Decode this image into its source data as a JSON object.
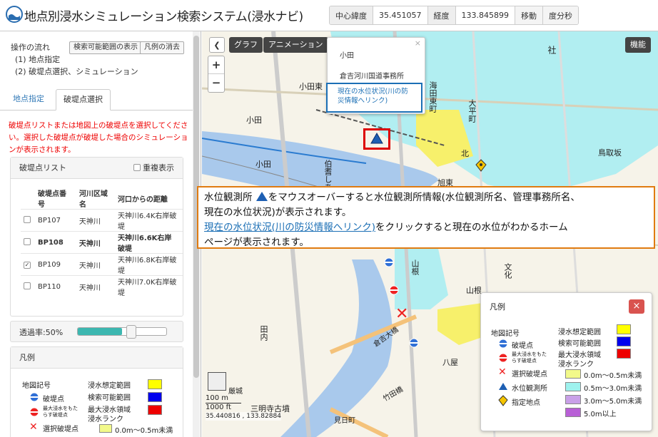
{
  "header": {
    "title": "地点別浸水シミュレーション検索システム(浸水ナビ)",
    "lat_label": "中心緯度",
    "lat_value": "35.451057",
    "lon_label": "経度",
    "lon_value": "133.845899",
    "move_button": "移動",
    "dms_button": "度分秒"
  },
  "left": {
    "flow_title": "操作の流れ",
    "flow_step1": "(1) 地点指定",
    "flow_step2": "(2) 破堤点選択、シミュレーション",
    "search_range_button": "検索可能範囲の表示",
    "legend_clear_button": "凡例の消去",
    "tabs": [
      {
        "label": "地点指定"
      },
      {
        "label": "破堤点選択"
      }
    ],
    "instruction": "破堤点リストまたは地図上の破堤点を選択してください。選択した破堤点が破堤した場合のシミュレーションが表示されます。",
    "breach_list_title": "破堤点リスト",
    "overlap_label": "重複表示",
    "table_headers": [
      "破堤点番号",
      "河川区域名",
      "河口からの距離"
    ],
    "rows": [
      {
        "id": "BP107",
        "river": "天神川",
        "dist": "天神川6.4K右岸破堤",
        "checked": false,
        "bold": false
      },
      {
        "id": "BP108",
        "river": "天神川",
        "dist": "天神川6.6K右岸破堤",
        "checked": false,
        "bold": true
      },
      {
        "id": "BP109",
        "river": "天神川",
        "dist": "天神川6.8K右岸破堤",
        "checked": true,
        "bold": false
      },
      {
        "id": "BP110",
        "river": "天神川",
        "dist": "天神川7.0K右岸破堤",
        "checked": false,
        "bold": false
      }
    ],
    "opacity_label": "透過率:50%",
    "opacity_fraction": 0.5,
    "legend_title": "凡例",
    "legend_map_symbols": "地図記号",
    "legend_breach_point": "破堤点",
    "legend_max_point": "最大浸水をもたらす破堤点",
    "legend_selected": "選択破堤点",
    "legend_flood_range": "浸水想定範囲",
    "legend_search_range": "検索可能範囲",
    "legend_max_area": "最大浸水領域",
    "legend_rank": "浸水ランク",
    "legend_rank1": "0.0m〜0.5m未満"
  },
  "map": {
    "graph_button": "グラフ",
    "animation_button": "アニメーション",
    "features_button": "機能",
    "zoom_in": "+",
    "zoom_out": "−",
    "popup_station": "小田",
    "popup_office": "倉吉河川国道事務所",
    "popup_link": "現在の水位状況(川の防災情報へリンク)",
    "popup_close": "×",
    "callout_line1a": "水位観測所",
    "callout_line1b": "をマウスオーバーすると水位観測所情報(水位観測所名、管理事務所名、",
    "callout_line2": "現在の水位状況)が表示されます。",
    "callout_link": "現在の水位状況(川の防災情報へリンク)",
    "callout_line3a": "をクリックすると現在の水位がわかるホーム",
    "callout_line4": "ページが表示されます。",
    "place_labels": [
      "小田東",
      "小田",
      "伯耆しあ",
      "小田",
      "海田東町",
      "大平町",
      "鳥取坂",
      "社",
      "旭東",
      "北",
      "山根",
      "文化",
      "山根",
      "八屋",
      "田内",
      "倉吉大橋",
      "竹田橋",
      "三明寺古墳",
      "見日町",
      "厳城"
    ],
    "legend_title": "凡例",
    "legend_close": "×",
    "legend_map_symbols": "地図記号",
    "legend_breach": "破堤点",
    "legend_max": "最大浸水をもたらす破堤点",
    "legend_selected": "選択破堤点",
    "legend_station": "水位観測所",
    "legend_point": "指定地点",
    "legend_flood_range": "浸水想定範囲",
    "legend_search_range": "検索可能範囲",
    "legend_max_area": "最大浸水領域",
    "legend_rank": "浸水ランク",
    "ranks": [
      {
        "label": "0.0m〜0.5m未満",
        "color": "#f2f98a"
      },
      {
        "label": "0.5m〜3.0m未満",
        "color": "#9ef2ee"
      },
      {
        "label": "3.0m〜5.0m未満",
        "color": "#c9a0e8"
      },
      {
        "label": "5.0m以上",
        "color": "#b85fd6"
      }
    ],
    "scale_100": "100 m",
    "scale_1000": "1000 ft",
    "coords": "35.440816 , 133.82884"
  },
  "colors": {
    "flood_cyan": "#a5ecf2",
    "flood_yellow": "#f7f06b",
    "river_blue": "#a9c9ec",
    "accent_orange": "#e07b10",
    "link_blue": "#1b6fb5"
  }
}
